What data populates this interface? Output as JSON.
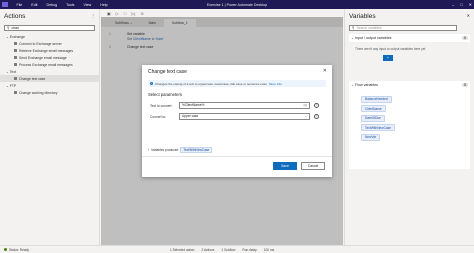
{
  "app": {
    "window_title": "Exercise 1 | Power Automate Desktop",
    "menu": [
      "File",
      "Edit",
      "Debug",
      "Tools",
      "View",
      "Help"
    ]
  },
  "actions_pane": {
    "title": "Actions",
    "search_value": "chan",
    "groups": [
      {
        "label": "Exchange",
        "items": [
          "Connect to Exchange server",
          "Retrieve Exchange email messages",
          "Send Exchange email message",
          "Process Exchange email messages"
        ]
      },
      {
        "label": "Text",
        "items": [
          "Change text case"
        ]
      },
      {
        "label": "FTP",
        "items": [
          "Change working directory"
        ]
      }
    ]
  },
  "toolbar": {
    "subflows_label": "Subflows"
  },
  "tabs": [
    {
      "label": "Main"
    },
    {
      "label": "Subflow_1"
    }
  ],
  "flow_steps": [
    {
      "num": "1",
      "title": "Set variable",
      "sub_prefix": "Set",
      "sub_var": "ClientName",
      "sub_mid": "to",
      "sub_val": "'Kate'"
    },
    {
      "num": "2",
      "title": "Change text case",
      "sub_prefix": "",
      "sub_var": "",
      "sub_mid": "",
      "sub_val": ""
    }
  ],
  "variables_pane": {
    "title": "Variables",
    "search_placeholder": "Search variables",
    "io_section": {
      "label": "Input / output variables",
      "count": "0"
    },
    "io_empty_text": "There aren't any input or output variables here yet",
    "io_button": "+",
    "flow_section": {
      "label": "Flow variables",
      "count": "5"
    },
    "flow_variables": [
      "BalanceNeeded",
      "ClientName",
      "DateOfDue",
      "TextWithNewCase",
      "NewVar"
    ]
  },
  "modal": {
    "title": "Change text case",
    "info_text": "Changes the casing of a text to uppercase, lowercase, title case or sentence case",
    "info_link": "More info",
    "section_title": "Select parameters",
    "text_to_convert_label": "Text to convert:",
    "text_to_convert_value": "%ClientName%",
    "convert_to_label": "Convert to:",
    "convert_to_value": "Upper case",
    "produced_label": "Variables produced",
    "produced_chip": "TextWithNewCase",
    "save_label": "Save",
    "cancel_label": "Cancel"
  },
  "statusbar": {
    "status": "Status: Ready",
    "selected": "1 Selected action",
    "total": "2 Actions",
    "subflows": "1 Subflow",
    "run_delay_label": "Run delay",
    "run_delay_value": "100 ms"
  },
  "colors": {
    "titlebar": "#1f1a56",
    "accent": "#0f6cbd"
  }
}
